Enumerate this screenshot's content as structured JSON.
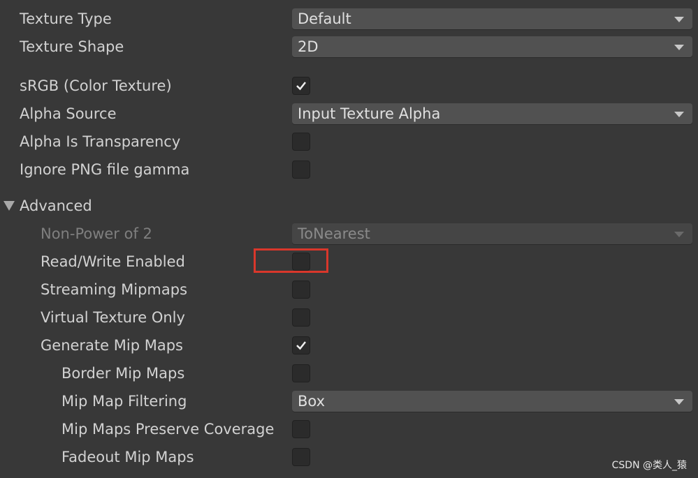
{
  "fields": {
    "texture_type": {
      "label": "Texture Type",
      "value": "Default"
    },
    "texture_shape": {
      "label": "Texture Shape",
      "value": "2D"
    },
    "srgb": {
      "label": "sRGB (Color Texture)",
      "checked": true
    },
    "alpha_source": {
      "label": "Alpha Source",
      "value": "Input Texture Alpha"
    },
    "alpha_is_transparency": {
      "label": "Alpha Is Transparency",
      "checked": false
    },
    "ignore_png_gamma": {
      "label": "Ignore PNG file gamma",
      "checked": false
    }
  },
  "advanced": {
    "label": "Advanced",
    "expanded": true,
    "non_power_of_2": {
      "label": "Non-Power of 2",
      "value": "ToNearest",
      "disabled": true
    },
    "read_write": {
      "label": "Read/Write Enabled",
      "checked": false,
      "highlighted": true
    },
    "streaming_mipmaps": {
      "label": "Streaming Mipmaps",
      "checked": false
    },
    "virtual_texture_only": {
      "label": "Virtual Texture Only",
      "checked": false
    },
    "generate_mip_maps": {
      "label": "Generate Mip Maps",
      "checked": true
    },
    "border_mip_maps": {
      "label": "Border Mip Maps",
      "checked": false
    },
    "mip_map_filtering": {
      "label": "Mip Map Filtering",
      "value": "Box"
    },
    "preserve_coverage": {
      "label": "Mip Maps Preserve Coverage",
      "checked": false
    },
    "fadeout_mip_maps": {
      "label": "Fadeout Mip Maps",
      "checked": false
    }
  },
  "colors": {
    "background": "#383838",
    "dropdown": "#515151",
    "checkbox": "#2b2b2b",
    "highlight": "#d9372b"
  },
  "watermark": "CSDN @类人_猿"
}
